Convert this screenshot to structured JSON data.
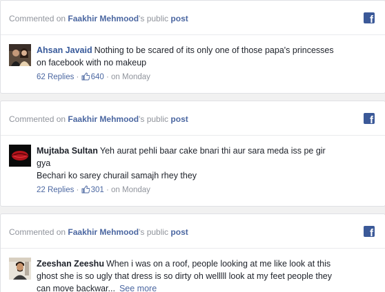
{
  "colors": {
    "link": "#365899",
    "meta_link": "#4b67a1",
    "muted": "#90949c",
    "text": "#1d2129",
    "facebook_brand": "#3b5998",
    "page_bg": "#f1f1f1"
  },
  "header": {
    "prefix": "Commented on",
    "owner": "Faakhir Mehmood",
    "suffix": "'s public",
    "post_label": "post",
    "icon": "facebook-icon",
    "icon_glyph": "f"
  },
  "comments": [
    {
      "author": "Ahsan Javaid",
      "lines": [
        "Nothing to be scared of its only one of those papa's princesses",
        "on facebook with no makeup"
      ],
      "replies": "62 Replies",
      "likes": "640",
      "time": "on Monday",
      "avatar_icon": "profile-photo-couple"
    },
    {
      "author": "Mujtaba Sultan",
      "lines": [
        "Yeh aurat pehli baar cake bnari thi aur sara meda iss pe gir",
        "gya",
        "Bechari ko sarey churail samajh rhey they"
      ],
      "replies": "22 Replies",
      "likes": "301",
      "time": "on Monday",
      "avatar_icon": "profile-photo-lips"
    },
    {
      "author": "Zeeshan Zeeshu",
      "lines": [
        "When i was on a roof, people looking at me like look at this",
        "ghost she is so ugly that dress is so dirty oh welllll look at my feet people they",
        "can move backwar..."
      ],
      "see_more": "See more",
      "avatar_icon": "profile-photo-man"
    }
  ]
}
